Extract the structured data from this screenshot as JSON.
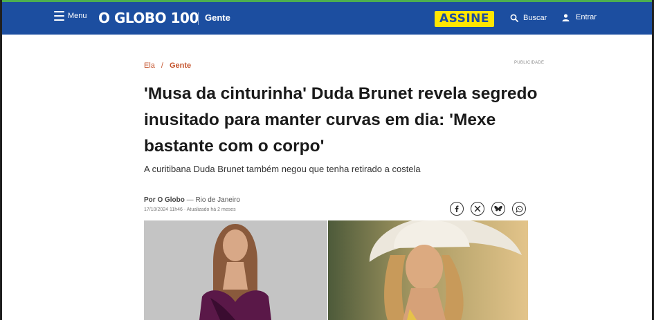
{
  "header": {
    "menu_label": "Menu",
    "logo_text": "O GLOBO 100",
    "section": "Gente",
    "subscribe_label": "ASSINE",
    "search_label": "Buscar",
    "login_label": "Entrar"
  },
  "breadcrumb": {
    "parent": "Ela",
    "separator": "/",
    "current": "Gente"
  },
  "ad_label": "PUBLICIDADE",
  "article": {
    "title": "'Musa da cinturinha' Duda Brunet revela segredo inusitado para manter curvas em dia: 'Mexe bastante com o corpo'",
    "subtitle": "A curitibana Duda Brunet também negou que tenha retirado a costela",
    "author": "Por O Globo",
    "location": "— Rio de Janeiro",
    "datetime": "17/10/2024 11h46 · Atualizado há 2 meses"
  },
  "share_icons": [
    "facebook-icon",
    "x-icon",
    "bluesky-icon",
    "whatsapp-icon"
  ],
  "colors": {
    "header_bg": "#1c4ea0",
    "accent_green": "#4caf50",
    "subscribe_bg": "#ffe600",
    "breadcrumb": "#c4532c"
  }
}
